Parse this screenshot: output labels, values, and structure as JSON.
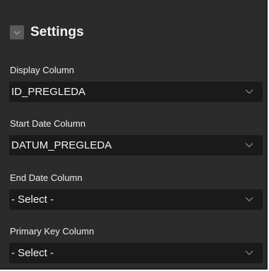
{
  "settings": {
    "title": "Settings",
    "fields": [
      {
        "label": "Display Column",
        "value": "ID_PREGLEDA"
      },
      {
        "label": "Start Date Column",
        "value": "DATUM_PREGLEDA"
      },
      {
        "label": "End Date Column",
        "value": "- Select -"
      },
      {
        "label": "Primary Key Column",
        "value": "- Select -"
      }
    ]
  },
  "colors": {
    "panel_background": "#2b2b2b",
    "select_background": "#1a1a1a",
    "text": "#f2f2f2",
    "toggle": "#5a5a5a"
  },
  "icons": {
    "header_toggle": "chevron-down-icon",
    "select_caret": "chevron-down-icon"
  }
}
